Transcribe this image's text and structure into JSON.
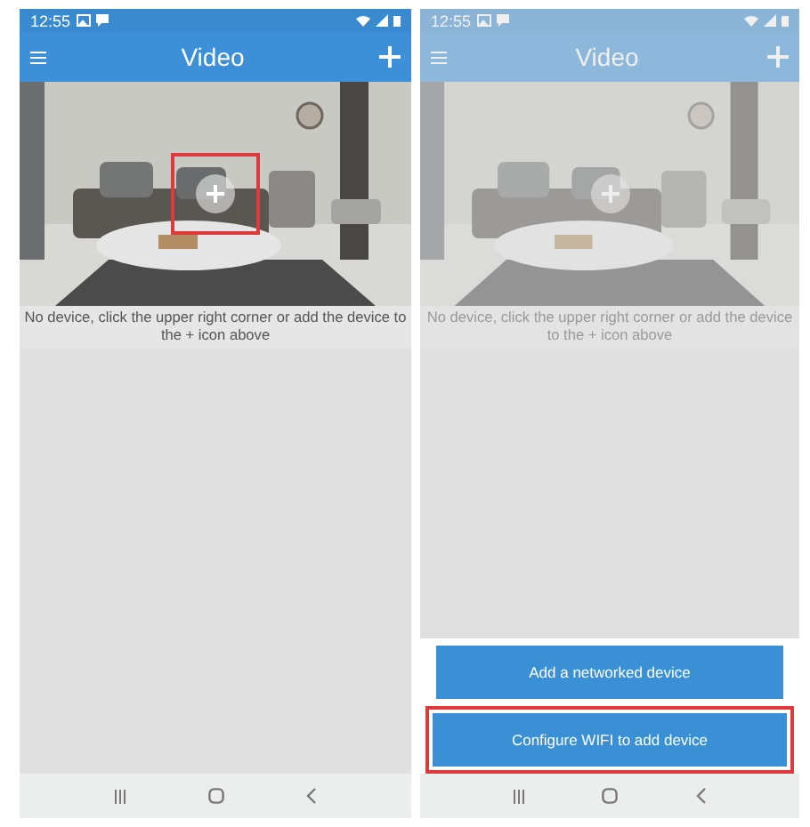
{
  "screens": [
    {
      "status_time": "12:55",
      "title": "Video",
      "dimmed": false,
      "add_highlighted": true,
      "message": "No device, click the upper right corner or add the device to the + icon above"
    },
    {
      "status_time": "12:55",
      "title": "Video",
      "dimmed": true,
      "add_highlighted": false,
      "message": "No device, click the upper right corner or add the device to the + icon above",
      "actions": [
        {
          "label": "Add a networked device",
          "highlighted": false
        },
        {
          "label": "Configure WIFI to add device",
          "highlighted": true
        }
      ]
    }
  ]
}
